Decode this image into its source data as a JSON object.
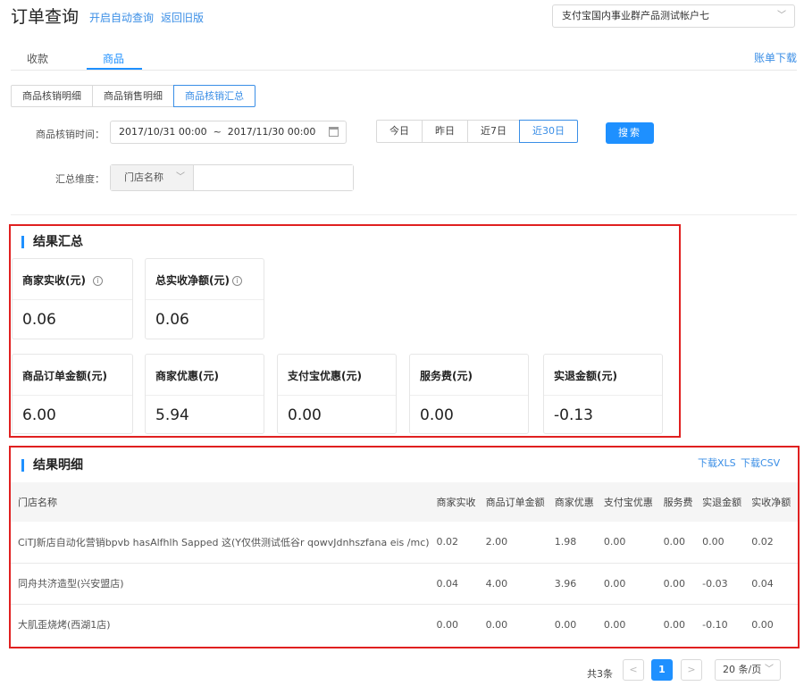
{
  "header": {
    "title": "订单查询",
    "links": [
      "开启自动查询",
      "返回旧版"
    ],
    "account": "支付宝国内事业群产品测试帐户七"
  },
  "tabs": {
    "items": [
      "收款",
      "商品"
    ],
    "active_index": 1,
    "bill_download": "账单下载"
  },
  "subtabs": {
    "items": [
      "商品核销明细",
      "商品销售明细",
      "商品核销汇总"
    ],
    "active_index": 2
  },
  "filters": {
    "time_label": "商品核销时间：",
    "date_range": "2017/10/31 00:00  ~  2017/11/30 00:00",
    "quick_ranges": [
      "今日",
      "昨日",
      "近7日",
      "近30日"
    ],
    "active_quick": 3,
    "search_label": "搜索",
    "dimension_label": "汇总维度：",
    "dimension_value": "门店名称",
    "dimension_input": ""
  },
  "summary": {
    "title": "结果汇总",
    "top_cards": [
      {
        "label": "商家实收(元)",
        "value": "0.06",
        "has_info": true
      },
      {
        "label": "总实收净额(元)",
        "value": "0.06",
        "has_info": true
      }
    ],
    "bottom_cards": [
      {
        "label": "商品订单金额(元)",
        "value": "6.00"
      },
      {
        "label": "商家优惠(元)",
        "value": "5.94"
      },
      {
        "label": "支付宝优惠(元)",
        "value": "0.00"
      },
      {
        "label": "服务费(元)",
        "value": "0.00"
      },
      {
        "label": "实退金额(元)",
        "value": "-0.13"
      }
    ]
  },
  "details": {
    "title": "结果明细",
    "download_xls": "下载XLS",
    "download_csv": "下载CSV",
    "columns": [
      "门店名称",
      "商家实收",
      "商品订单金额",
      "商家优惠",
      "支付宝优惠",
      "服务费",
      "实退金额",
      "实收净额"
    ],
    "rows": [
      [
        "CiTJ新店自动化营销bpvb hasAlfhlh Sapped 这(Y仅供测试低谷r qowvJdnhszfana eis /mc)",
        "0.02",
        "2.00",
        "1.98",
        "0.00",
        "0.00",
        "0.00",
        "0.02"
      ],
      [
        "同舟共济造型(兴安盟店)",
        "0.04",
        "4.00",
        "3.96",
        "0.00",
        "0.00",
        "-0.03",
        "0.04"
      ],
      [
        "大肌歪烧烤(西湖1店)",
        "0.00",
        "0.00",
        "0.00",
        "0.00",
        "0.00",
        "-0.10",
        "0.00"
      ]
    ]
  },
  "pagination": {
    "total": "共3条",
    "current": "1",
    "page_size": "20 条/页"
  },
  "colors": {
    "accent": "#1e90ff",
    "highlight_border": "#e02020"
  }
}
